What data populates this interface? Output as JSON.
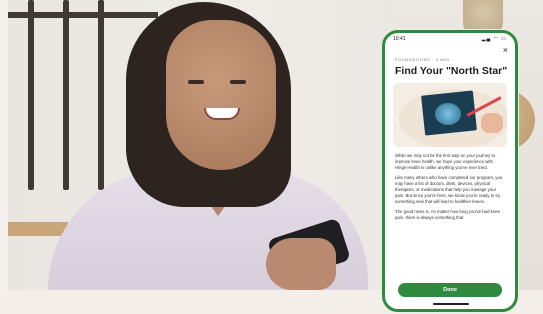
{
  "modal": {
    "status_time": "10:41",
    "status_icons": "▂▄ ◠ ▭",
    "close_label": "×",
    "eyebrow": "FOUNDATIONS · 3 MIN",
    "title": "Find Your \"North Star\"",
    "paragraphs": [
      "While we may not be the first step on your journey to improve knee health, we hope your experience with Hinge Health is unlike anything you've ever tried.",
      "Like many others who have completed our program, you may have a list of doctors, diets, devices, physical therapists, or medications that help you manage your pain. But since you're here, we know you're ready to try something new that will lead to healthier knees.",
      "The good news is, no matter how long you've had knee pain, there is always something that"
    ],
    "done_label": "Done"
  },
  "colors": {
    "accent": "#2f8a3f",
    "background": "#f4f1ec"
  },
  "icons": [
    "close-icon"
  ]
}
